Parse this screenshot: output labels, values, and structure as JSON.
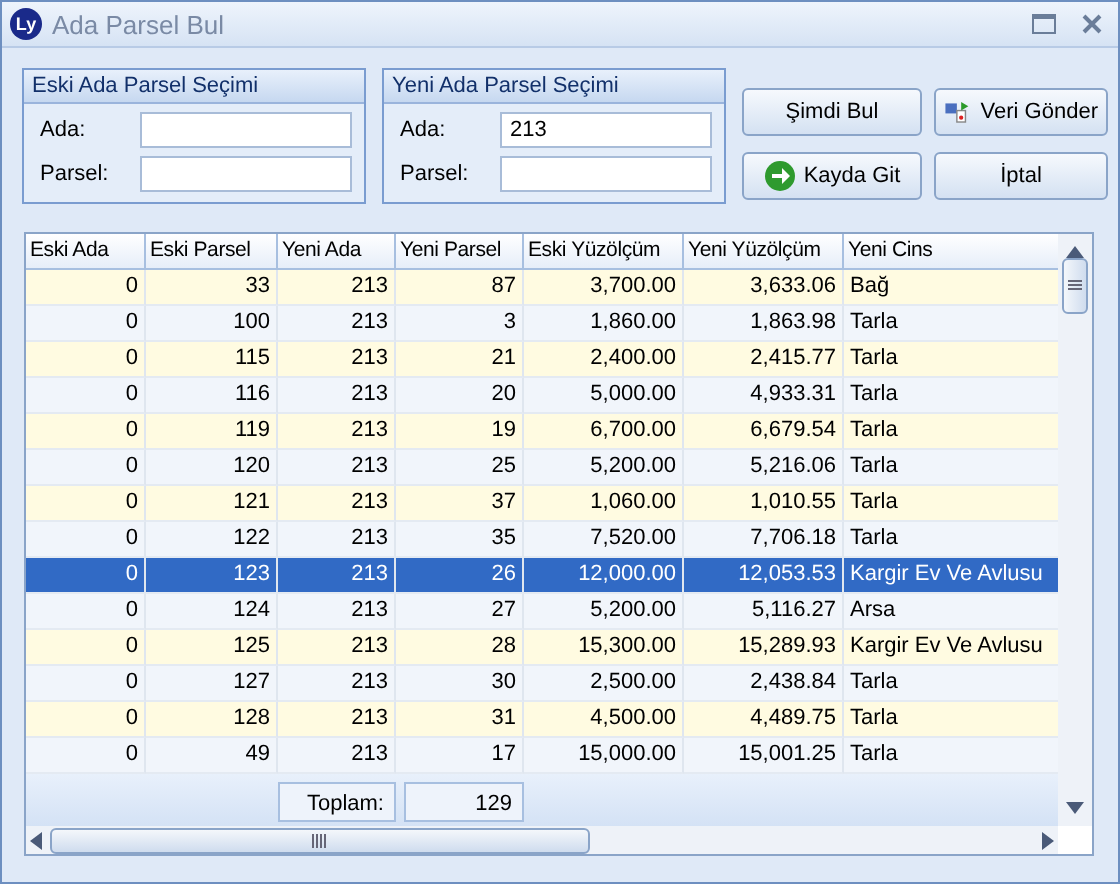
{
  "window": {
    "title": "Ada Parsel Bul",
    "logo": "Ly"
  },
  "groups": [
    {
      "title": "Eski Ada Parsel Seçimi",
      "fields": [
        {
          "label": "Ada:"
        },
        {
          "label": "Parsel:"
        }
      ]
    },
    {
      "title": "Yeni Ada Parsel Seçimi",
      "fields": [
        {
          "label": "Ada:",
          "value": "213"
        },
        {
          "label": "Parsel:"
        }
      ]
    }
  ],
  "buttons": [
    {
      "label": "Şimdi Bul",
      "kind": "plain"
    },
    {
      "label": "Veri Gönder",
      "kind": "send"
    },
    {
      "label": "Kayda Git",
      "kind": "go"
    },
    {
      "label": "İptal",
      "kind": "plain"
    }
  ],
  "table": {
    "columns": [
      "Eski Ada",
      "Eski Parsel",
      "Yeni Ada",
      "Yeni Parsel",
      "Eski Yüzölçüm",
      "Yeni Yüzölçüm",
      "Yeni Cins"
    ],
    "rows": [
      {
        "cells": [
          "0",
          "33",
          "213",
          "87",
          "3,700.00",
          "3,633.06",
          "Bağ"
        ],
        "selected": false
      },
      {
        "cells": [
          "0",
          "100",
          "213",
          "3",
          "1,860.00",
          "1,863.98",
          "Tarla"
        ],
        "selected": false
      },
      {
        "cells": [
          "0",
          "115",
          "213",
          "21",
          "2,400.00",
          "2,415.77",
          "Tarla"
        ],
        "selected": false
      },
      {
        "cells": [
          "0",
          "116",
          "213",
          "20",
          "5,000.00",
          "4,933.31",
          "Tarla"
        ],
        "selected": false
      },
      {
        "cells": [
          "0",
          "119",
          "213",
          "19",
          "6,700.00",
          "6,679.54",
          "Tarla"
        ],
        "selected": false
      },
      {
        "cells": [
          "0",
          "120",
          "213",
          "25",
          "5,200.00",
          "5,216.06",
          "Tarla"
        ],
        "selected": false
      },
      {
        "cells": [
          "0",
          "121",
          "213",
          "37",
          "1,060.00",
          "1,010.55",
          "Tarla"
        ],
        "selected": false
      },
      {
        "cells": [
          "0",
          "122",
          "213",
          "35",
          "7,520.00",
          "7,706.18",
          "Tarla"
        ],
        "selected": false
      },
      {
        "cells": [
          "0",
          "123",
          "213",
          "26",
          "12,000.00",
          "12,053.53",
          "Kargir Ev Ve Avlusu"
        ],
        "selected": true
      },
      {
        "cells": [
          "0",
          "124",
          "213",
          "27",
          "5,200.00",
          "5,116.27",
          "Arsa"
        ],
        "selected": false
      },
      {
        "cells": [
          "0",
          "125",
          "213",
          "28",
          "15,300.00",
          "15,289.93",
          "Kargir Ev Ve Avlusu"
        ],
        "selected": false
      },
      {
        "cells": [
          "0",
          "127",
          "213",
          "30",
          "2,500.00",
          "2,438.84",
          "Tarla"
        ],
        "selected": false
      },
      {
        "cells": [
          "0",
          "128",
          "213",
          "31",
          "4,500.00",
          "4,489.75",
          "Tarla"
        ],
        "selected": false
      },
      {
        "cells": [
          "0",
          "49",
          "213",
          "17",
          "15,000.00",
          "15,001.25",
          "Tarla"
        ],
        "selected": false
      }
    ],
    "footer": {
      "label": "Toplam:",
      "value": "129"
    }
  }
}
